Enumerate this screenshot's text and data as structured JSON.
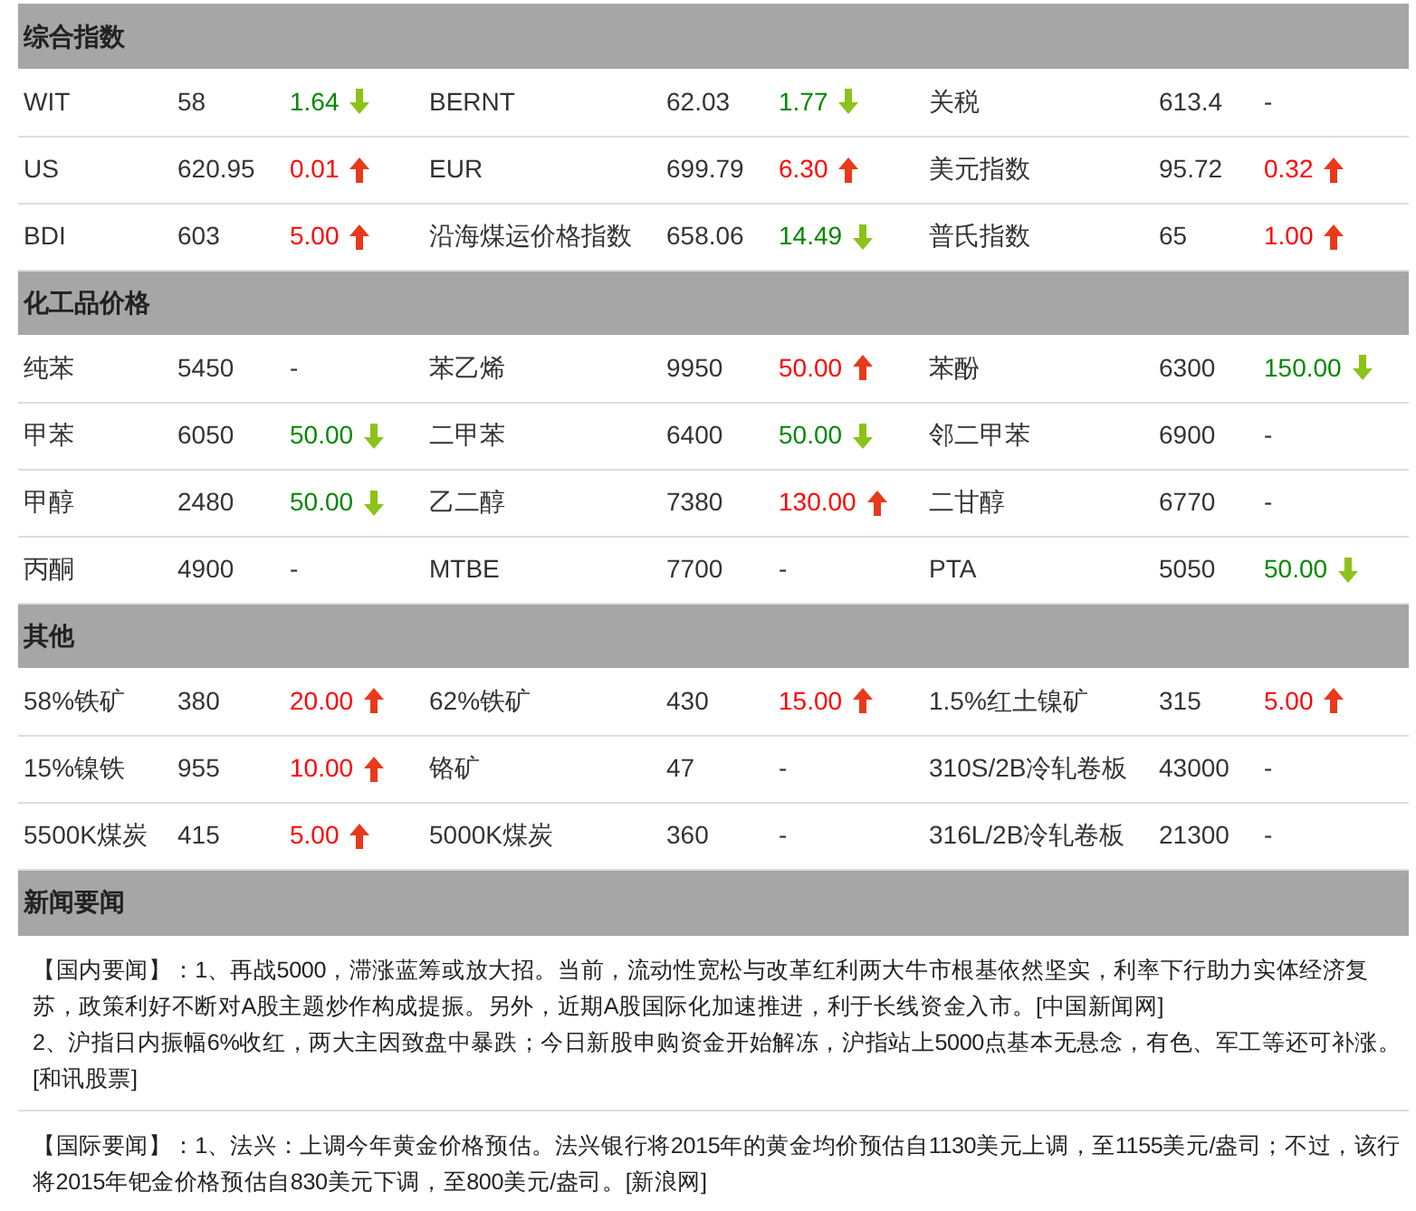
{
  "sections": [
    {
      "title": "综合指数",
      "rows": [
        [
          {
            "name": "WIT",
            "value": "58",
            "change": "1.64",
            "rising": false
          },
          {
            "name": "BERNT",
            "value": "62.03",
            "change": "1.77",
            "rising": false
          },
          {
            "name": "关税",
            "value": "613.4",
            "change": "-"
          }
        ],
        [
          {
            "name": "US",
            "value": "620.95",
            "change": "0.01",
            "rising": true
          },
          {
            "name": "EUR",
            "value": "699.79",
            "change": "6.30",
            "rising": true
          },
          {
            "name": "美元指数",
            "value": "95.72",
            "change": "0.32",
            "rising": true
          }
        ],
        [
          {
            "name": "BDI",
            "value": "603",
            "change": "5.00",
            "rising": true
          },
          {
            "name": "沿海煤运价格指数",
            "value": "658.06",
            "change": "14.49",
            "rising": false
          },
          {
            "name": "普氏指数",
            "value": "65",
            "change": "1.00",
            "rising": true
          }
        ]
      ]
    },
    {
      "title": "化工品价格",
      "rows": [
        [
          {
            "name": "纯苯",
            "value": "5450",
            "change": "-"
          },
          {
            "name": "苯乙烯",
            "value": "9950",
            "change": "50.00",
            "rising": true
          },
          {
            "name": "苯酚",
            "value": "6300",
            "change": "150.00",
            "rising": false
          }
        ],
        [
          {
            "name": "甲苯",
            "value": "6050",
            "change": "50.00",
            "rising": false
          },
          {
            "name": "二甲苯",
            "value": "6400",
            "change": "50.00",
            "rising": false
          },
          {
            "name": "邻二甲苯",
            "value": "6900",
            "change": "-"
          }
        ],
        [
          {
            "name": "甲醇",
            "value": "2480",
            "change": "50.00",
            "rising": false
          },
          {
            "name": "乙二醇",
            "value": "7380",
            "change": "130.00",
            "rising": true
          },
          {
            "name": "二甘醇",
            "value": "6770",
            "change": "-"
          }
        ],
        [
          {
            "name": "丙酮",
            "value": "4900",
            "change": "-"
          },
          {
            "name": "MTBE",
            "value": "7700",
            "change": "-"
          },
          {
            "name": "PTA",
            "value": "5050",
            "change": "50.00",
            "rising": false
          }
        ]
      ]
    },
    {
      "title": "其他",
      "rows": [
        [
          {
            "name": "58%铁矿",
            "value": "380",
            "change": "20.00",
            "rising": true
          },
          {
            "name": "62%铁矿",
            "value": "430",
            "change": "15.00",
            "rising": true
          },
          {
            "name": "1.5%红土镍矿",
            "value": "315",
            "change": "5.00",
            "rising": true
          }
        ],
        [
          {
            "name": "15%镍铁",
            "value": "955",
            "change": "10.00",
            "rising": true
          },
          {
            "name": "铬矿",
            "value": "47",
            "change": "-"
          },
          {
            "name": "310S/2B冷轧卷板",
            "value": "43000",
            "change": "-"
          }
        ],
        [
          {
            "name": "5500K煤炭",
            "value": "415",
            "change": "5.00",
            "rising": true
          },
          {
            "name": "5000K煤炭",
            "value": "360",
            "change": "-"
          },
          {
            "name": "316L/2B冷轧卷板",
            "value": "21300",
            "change": "-"
          }
        ]
      ]
    }
  ],
  "news": {
    "title": "新闻要闻",
    "items": [
      [
        "【国内要闻】：1、再战5000，滞涨蓝筹或放大招。当前，流动性宽松与改革红利两大牛市根基依然坚实，利率下行助力实体经济复苏，政策利好不断对A股主题炒作构成提振。另外，近期A股国际化加速推进，利于长线资金入市。[中国新闻网]",
        "2、沪指日内振幅6%收红，两大主因致盘中暴跌；今日新股申购资金开始解冻，沪指站上5000点基本无悬念，有色、军工等还可补涨。[和讯股票]"
      ],
      [
        "【国际要闻】：1、法兴：上调今年黄金价格预估。法兴银行将2015年的黄金均价预估自1130美元上调，至1155美元/盎司；不过，该行将2015年钯金价格预估自830美元下调，至800美元/盎司。[新浪网]"
      ]
    ]
  }
}
